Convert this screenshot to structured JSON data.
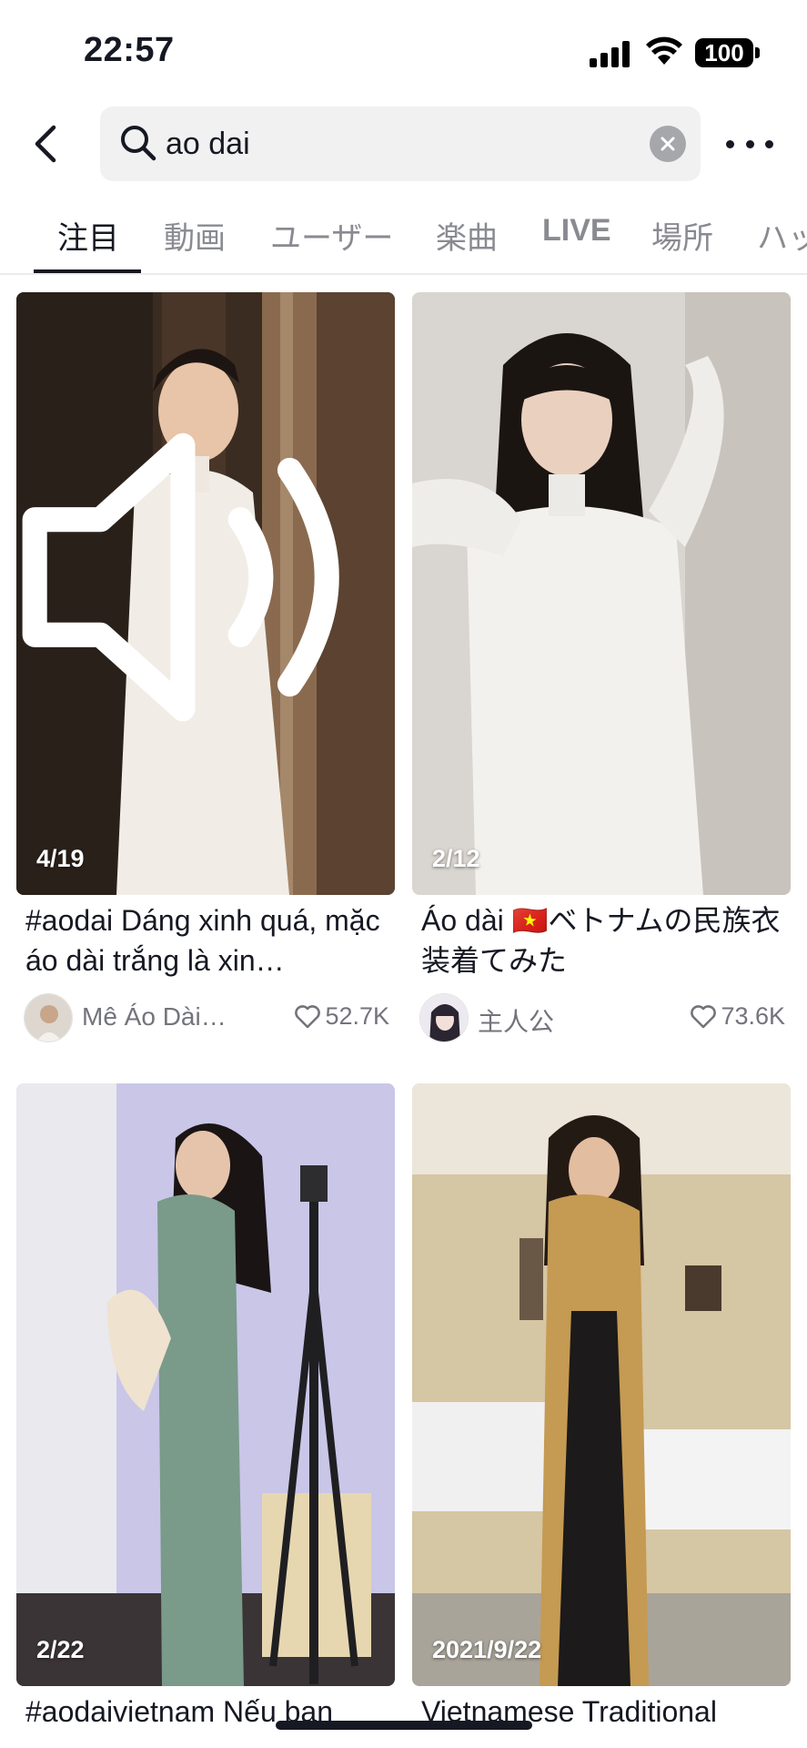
{
  "status_bar": {
    "time": "22:57",
    "battery": "100"
  },
  "search": {
    "query": "ao dai"
  },
  "tabs": [
    {
      "label": "注目"
    },
    {
      "label": "動画"
    },
    {
      "label": "ユーザー"
    },
    {
      "label": "楽曲"
    },
    {
      "label": "LIVE"
    },
    {
      "label": "場所"
    },
    {
      "label": "ハッシュタグ"
    }
  ],
  "results": [
    {
      "counter": "4/19",
      "caption": "#aodai Dáng xinh quá, mặc áo dài trắng là xin…",
      "author": "Mê Áo Dài…",
      "likes": "52.7K"
    },
    {
      "counter": "2/12",
      "caption": "Áo dài 🇻🇳ベトナムの民族衣装着てみた",
      "author": "主人公",
      "likes": "73.6K"
    },
    {
      "counter": "2/22",
      "caption": "#aodaivietnam Nếu bạn"
    },
    {
      "counter": "2021/9/22",
      "caption": "Vietnamese Traditional"
    }
  ],
  "colors": {
    "text": "#161823",
    "muted": "#8a8b91",
    "search_bg": "#f1f1f2"
  }
}
